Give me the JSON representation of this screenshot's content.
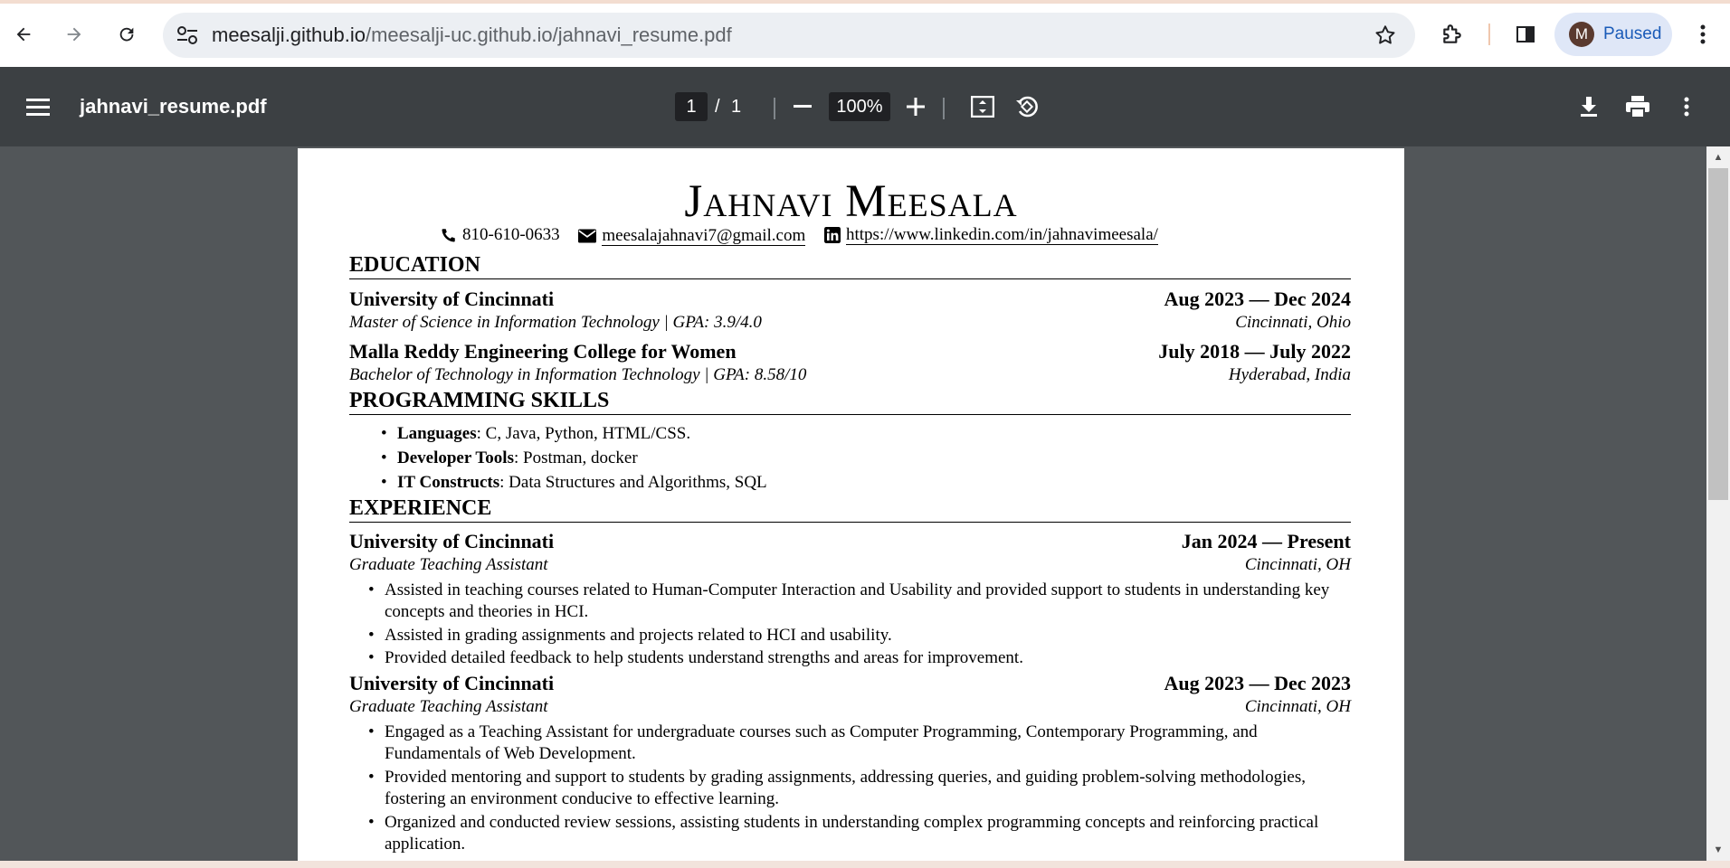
{
  "browser": {
    "url_host": "meesalji.github.io",
    "url_path": "/meesalji-uc.github.io/jahnavi_resume.pdf",
    "profile_initial": "M",
    "profile_status": "Paused"
  },
  "viewer": {
    "title": "jahnavi_resume.pdf",
    "page_current": "1",
    "page_separator": "/",
    "page_total": "1",
    "zoom": "100%"
  },
  "resume": {
    "name_first": "Jahnavi",
    "name_last": "Meesala",
    "phone": "810-610-0633",
    "email": "meesalajahnavi7@gmail.com",
    "linkedin": "https://www.linkedin.com/in/jahnavimeesala/",
    "education": {
      "heading": "EDUCATION",
      "items": [
        {
          "school": "University of Cincinnati",
          "dates": "Aug 2023 — Dec 2024",
          "degree": "Master of Science in Information Technology | GPA: 3.9/4.0",
          "location": "Cincinnati, Ohio"
        },
        {
          "school": "Malla Reddy Engineering College for Women",
          "dates": "July 2018 — July 2022",
          "degree": "Bachelor of Technology in Information Technology | GPA: 8.58/10",
          "location": "Hyderabad, India"
        }
      ]
    },
    "skills": {
      "heading": "PROGRAMMING SKILLS",
      "items": [
        {
          "label": "Languages",
          "value": ": C, Java, Python, HTML/CSS."
        },
        {
          "label": "Developer Tools",
          "value": ": Postman, docker"
        },
        {
          "label": "IT Constructs",
          "value": ": Data Structures and Algorithms, SQL"
        }
      ]
    },
    "experience": {
      "heading": "EXPERIENCE",
      "items": [
        {
          "org": "University of Cincinnati",
          "dates": "Jan 2024 — Present",
          "role": "Graduate Teaching Assistant",
          "location": "Cincinnati, OH",
          "bullets": [
            "Assisted in teaching courses related to Human-Computer Interaction and Usability and provided support to students in understanding key concepts and theories in HCI.",
            "Assisted in grading assignments and projects related to HCI and usability.",
            "Provided detailed feedback to help students understand strengths and areas for improvement."
          ]
        },
        {
          "org": "University of Cincinnati",
          "dates": "Aug 2023 — Dec 2023",
          "role": "Graduate Teaching Assistant",
          "location": "Cincinnati, OH",
          "bullets": [
            "Engaged as a Teaching Assistant for undergraduate courses such as Computer Programming, Contemporary Programming, and Fundamentals of Web Development.",
            "Provided mentoring and support to students by grading assignments, addressing queries, and guiding problem-solving methodologies, fostering an environment conducive to effective learning.",
            "Organized and conducted review sessions, assisting students in understanding complex programming concepts and reinforcing practical application."
          ]
        }
      ]
    }
  }
}
